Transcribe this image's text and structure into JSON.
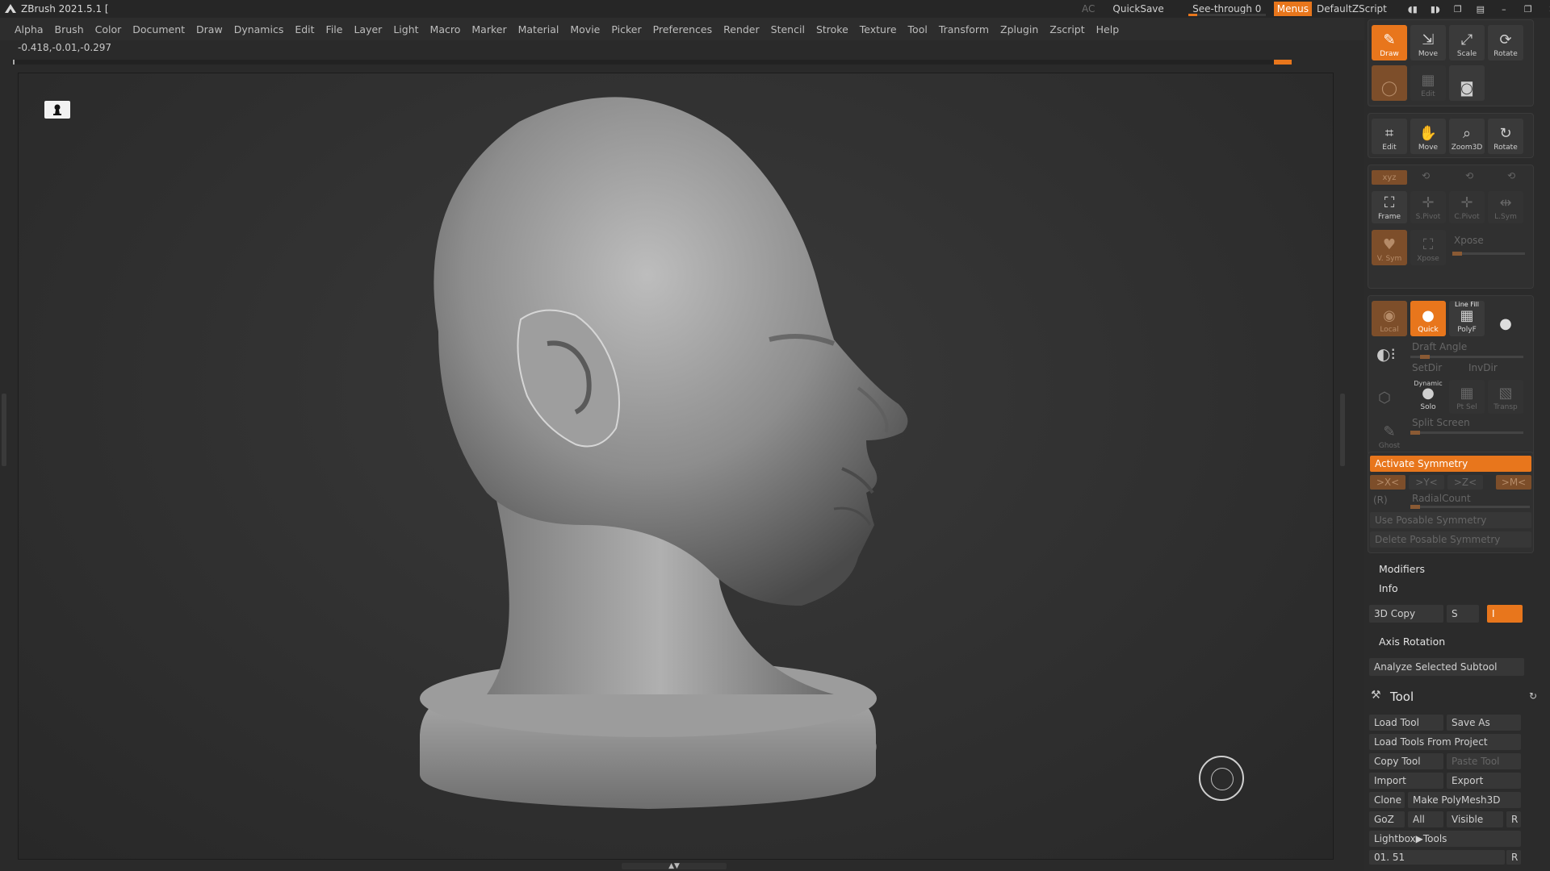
{
  "titlebar": {
    "title": "ZBrush 2021.5.1 [",
    "ac": "AC",
    "quicksave": "QuickSave",
    "see_through": "See-through   0",
    "see_through_value": 0,
    "menus": "Menus",
    "script": "DefaultZScript"
  },
  "menubar": {
    "items": [
      "Alpha",
      "Brush",
      "Color",
      "Document",
      "Draw",
      "Dynamics",
      "Edit",
      "File",
      "Layer",
      "Light",
      "Macro",
      "Marker",
      "Material",
      "Movie",
      "Picker",
      "Preferences",
      "Render",
      "Stencil",
      "Stroke",
      "Texture",
      "Tool",
      "Transform",
      "Zplugin",
      "Zscript",
      "Help"
    ]
  },
  "coords": "-0.418,-0.01,-0.297",
  "shelf": {
    "row1": [
      "Draw",
      "Move",
      "Scale",
      "Rotate"
    ],
    "row2_edit": "Edit",
    "nav": [
      "Edit",
      "Move",
      "Zoom3D",
      "Rotate"
    ],
    "xyz": "xyz",
    "frame_row": [
      "Frame",
      "S.Pivot",
      "C.Pivot",
      "L.Sym"
    ],
    "vsym": "V. Sym",
    "xpose_small": "Xpose",
    "xpose": "Xpose",
    "local": "Local",
    "quick": "Quick",
    "line_fill": "Line Fill",
    "polyf": "PolyF",
    "draft_angle": "Draft Angle",
    "setdir": "SetDir",
    "invdir": "InvDir",
    "dynamic": "Dynamic",
    "solo": "Solo",
    "ptsel": "Pt Sel",
    "transp": "Transp",
    "split_screen": "Split Screen",
    "ghost": "Ghost",
    "activate_symmetry": "Activate Symmetry",
    "axes": [
      ">X<",
      ">Y<",
      ">Z<",
      ">M<"
    ],
    "r_label": "(R)",
    "radial_count": "RadialCount",
    "use_posable": "Use Posable Symmetry",
    "delete_posable": "Delete Posable Symmetry",
    "modifiers": "Modifiers",
    "info": "Info",
    "copy3d": "3D Copy",
    "s_label": "S",
    "i_label": "I",
    "axis_rotation": "Axis Rotation",
    "analyze": "Analyze Selected Subtool",
    "tool_title": "Tool",
    "load_tool": "Load Tool",
    "save_as": "Save As",
    "load_from_project": "Load Tools From Project",
    "copy_tool": "Copy Tool",
    "paste_tool": "Paste Tool",
    "import": "Import",
    "export": "Export",
    "clone": "Clone",
    "make_polymesh": "Make PolyMesh3D",
    "goz": "GoZ",
    "all": "All",
    "visible": "Visible",
    "r": "R",
    "lightbox_tools": "Lightbox▶Tools",
    "bottom_value": "01. 51",
    "bottom_r": "R"
  },
  "colors": {
    "accent": "#e8761c",
    "background": "#2a2a2a"
  }
}
